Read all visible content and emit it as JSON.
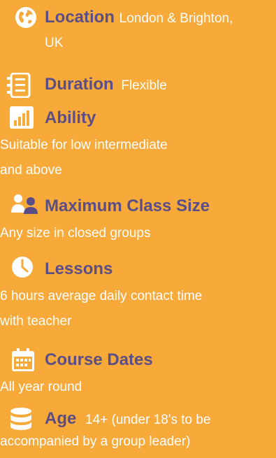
{
  "items": [
    {
      "icon": "globe-icon",
      "title": "Location",
      "value_line1": "London & Brighton,",
      "value_line2": "UK"
    },
    {
      "icon": "list-icon",
      "title": "Duration",
      "value": "Flexible"
    },
    {
      "icon": "bar-chart-icon",
      "title": "Ability",
      "desc_line1": "Suitable for low intermediate",
      "desc_line2": "and above"
    },
    {
      "icon": "people-icon",
      "title": "Maximum Class Size",
      "desc_line1": "Any size in closed groups"
    },
    {
      "icon": "clock-icon",
      "title": "Lessons",
      "desc_line1": "6 hours average daily contact time",
      "desc_line2": "with teacher"
    },
    {
      "icon": "calendar-icon",
      "title": "Course Dates",
      "desc_line1": "All year round"
    },
    {
      "icon": "database-icon",
      "title": "Age",
      "value": "14+ (under 18's to be",
      "desc_line2": "accompanied by a group leader)"
    }
  ],
  "colors": {
    "background": "#f7a93a",
    "title": "#5b4e86",
    "text": "#ffffff"
  }
}
